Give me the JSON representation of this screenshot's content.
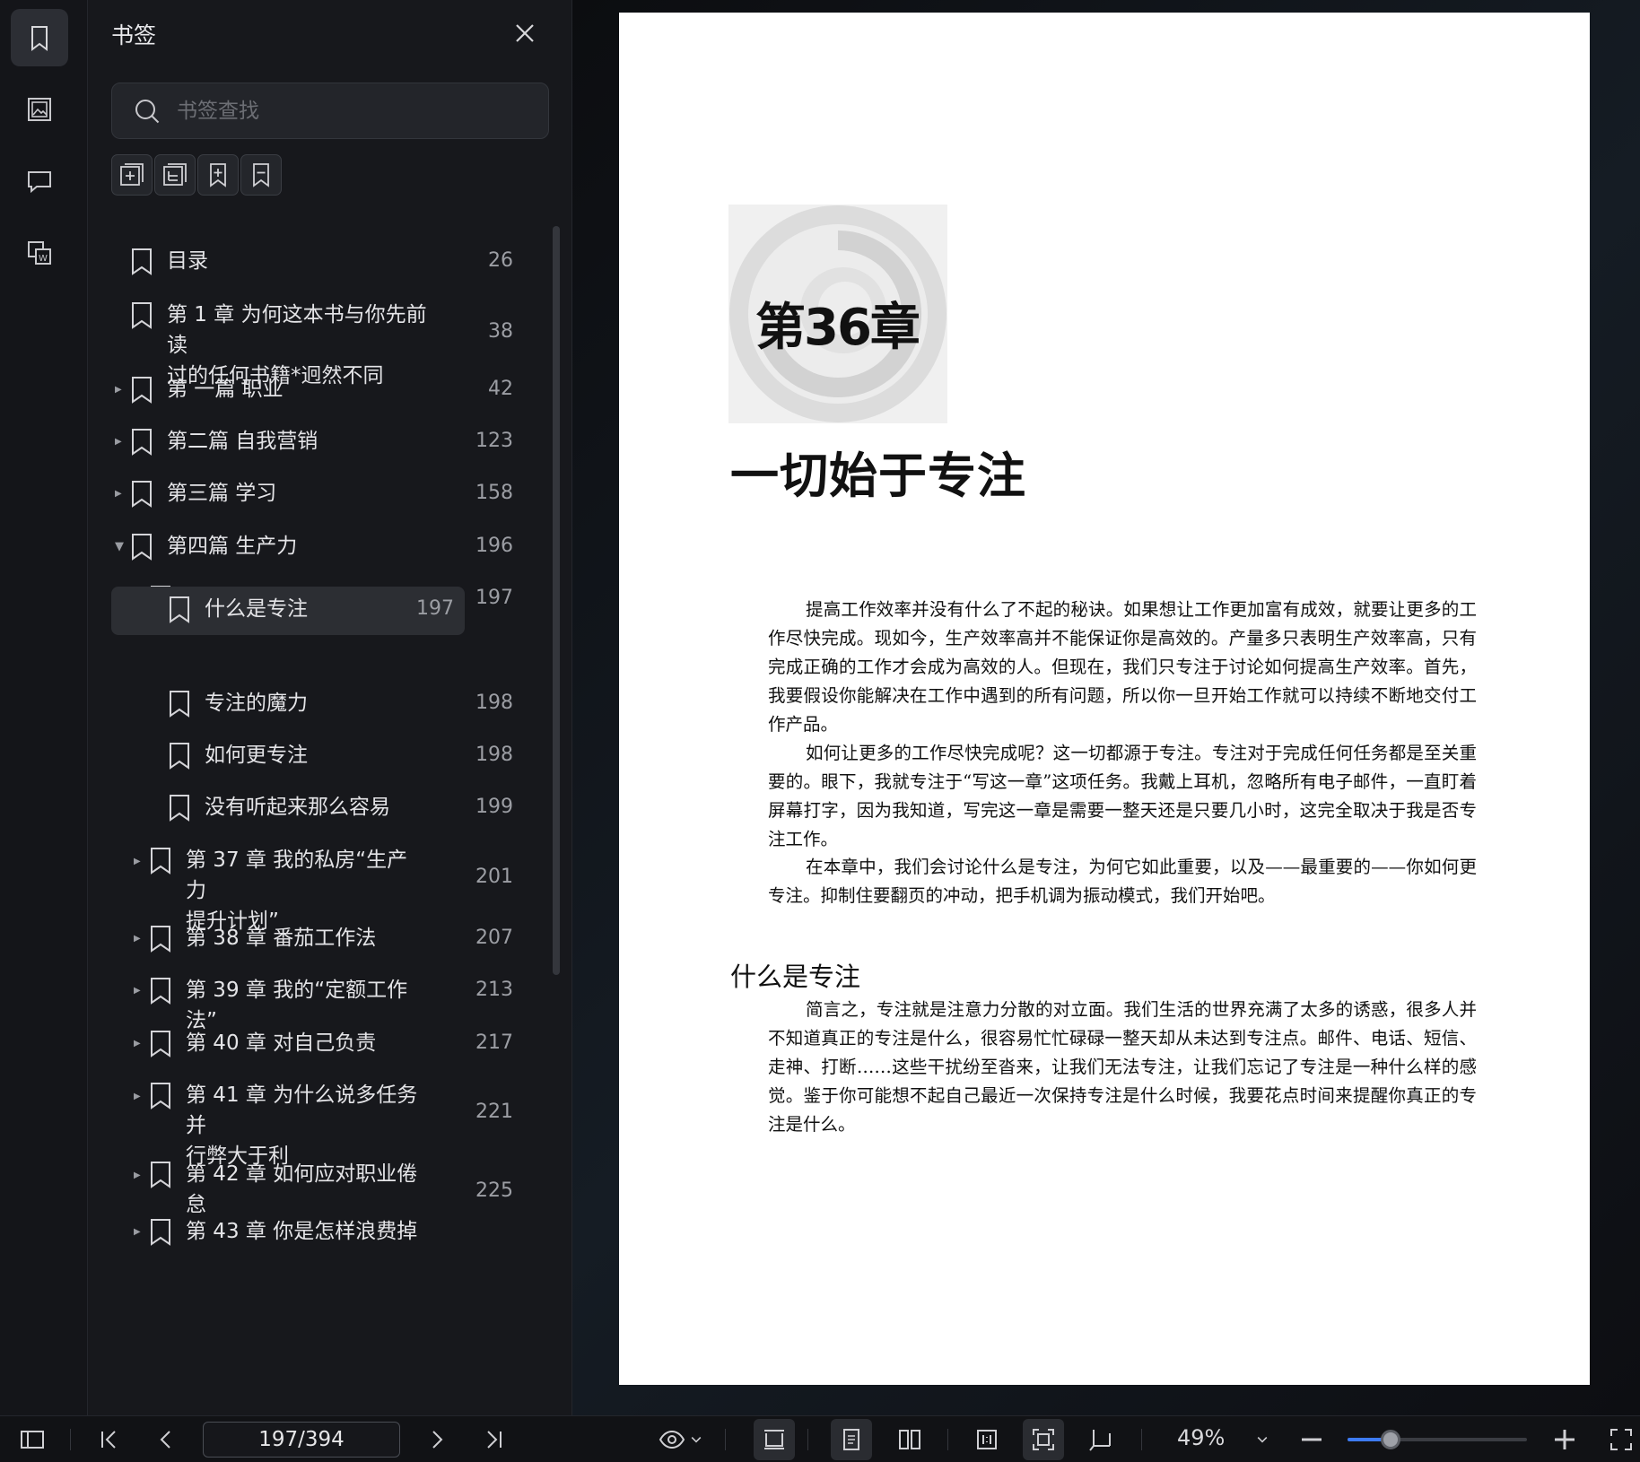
{
  "panel": {
    "title": "书签",
    "search_placeholder": "书签查找"
  },
  "bookmarks": [
    {
      "label": "目录",
      "page": "26",
      "level": 0,
      "expander": "none"
    },
    {
      "label": "第 1 章 为何这本书与你先前读\n过的任何书籍*迥然不同",
      "page": "38",
      "level": 0,
      "expander": "none"
    },
    {
      "label": "第 一篇 职业",
      "page": "42",
      "level": 0,
      "expander": "collapsed"
    },
    {
      "label": "第二篇 自我营销",
      "page": "123",
      "level": 0,
      "expander": "collapsed"
    },
    {
      "label": "第三篇 学习",
      "page": "158",
      "level": 0,
      "expander": "collapsed"
    },
    {
      "label": "第四篇 生产力",
      "page": "196",
      "level": 0,
      "expander": "expanded"
    },
    {
      "label": "第 36 章 一切始于专注",
      "page": "197",
      "level": 1,
      "expander": "expanded"
    },
    {
      "label": "什么是专注",
      "page": "197",
      "level": 2,
      "expander": "none",
      "selected": true
    },
    {
      "label": "专注的魔力",
      "page": "198",
      "level": 2,
      "expander": "none"
    },
    {
      "label": "如何更专注",
      "page": "198",
      "level": 2,
      "expander": "none"
    },
    {
      "label": "没有听起来那么容易",
      "page": "199",
      "level": 2,
      "expander": "none"
    },
    {
      "label": "第 37 章 我的私房“生产力\n提升计划”",
      "page": "201",
      "level": 1,
      "expander": "collapsed"
    },
    {
      "label": "第 38 章 番茄工作法",
      "page": "207",
      "level": 1,
      "expander": "collapsed"
    },
    {
      "label": "第 39 章 我的“定额工作法”",
      "page": "213",
      "level": 1,
      "expander": "collapsed"
    },
    {
      "label": "第 40 章 对自己负责",
      "page": "217",
      "level": 1,
      "expander": "collapsed"
    },
    {
      "label": "第 41 章 为什么说多任务并\n行弊大于利",
      "page": "221",
      "level": 1,
      "expander": "collapsed"
    },
    {
      "label": "第 42 章 如何应对职业倦\n怠",
      "page": "225",
      "level": 1,
      "expander": "collapsed"
    },
    {
      "label": "第 43 章 你是怎样浪费掉",
      "page": "",
      "level": 1,
      "expander": "collapsed"
    }
  ],
  "document": {
    "chapter_number": "第36章",
    "chapter_title": "一切始于专注",
    "paragraphs": [
      "提高工作效率并没有什么了不起的秘诀。如果想让工作更加富有成效，就要让更多的工作尽快完成。现如今，生产效率高并不能保证你是高效的。产量多只表明生产效率高，只有完成正确的工作才会成为高效的人。但现在，我们只专注于讨论如何提高生产效率。首先，我要假设你能解决在工作中遇到的所有问题，所以你一旦开始工作就可以持续不断地交付工作产品。",
      "如何让更多的工作尽快完成呢？这一切都源于专注。专注对于完成任何任务都是至关重要的。眼下，我就专注于“写这一章”这项任务。我戴上耳机，忽略所有电子邮件，一直盯着屏幕打字，因为我知道，写完这一章是需要一整天还是只要几小时，这完全取决于我是否专注工作。",
      "在本章中，我们会讨论什么是专注，为何它如此重要，以及——最重要的——你如何更专注。抑制住要翻页的冲动，把手机调为振动模式，我们开始吧。"
    ],
    "section_heading": "什么是专注",
    "section_paragraph": "简言之，专注就是注意力分散的对立面。我们生活的世界充满了太多的诱惑，很多人并不知道真正的专注是什么，很容易忙忙碌碌一整天却从未达到专注点。邮件、电话、短信、走神、打断……这些干扰纷至沓来，让我们无法专注，让我们忘记了专注是一种什么样的感觉。鉴于你可能想不起自己最近一次保持专注是什么时候，我要花点时间来提醒你真正的专注是什么。"
  },
  "toolbar": {
    "page_indicator": "197/394",
    "zoom": "49%",
    "zoom_level": 0.24
  },
  "colors": {
    "accent": "#3d7bf5",
    "panel_bg": "#17181c",
    "selected_row": "#2c2e33"
  }
}
